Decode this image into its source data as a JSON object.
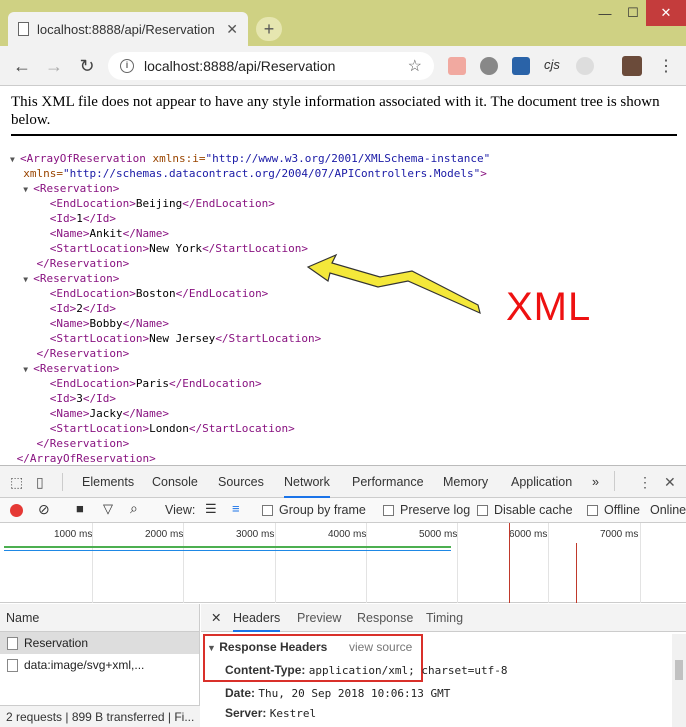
{
  "browser": {
    "tab_title": "localhost:8888/api/Reservation",
    "tab_close": "✕",
    "new_tab": "+",
    "url": "localhost:8888/api/Reservation",
    "window_controls": [
      "—",
      "☐",
      "✕"
    ]
  },
  "page": {
    "banner": "This XML file does not appear to have any style information associated with it. The document tree is shown below.",
    "annotation_label": "XML",
    "xml_root": {
      "open_tag": "<ArrayOfReservation",
      "attr1_name": " xmlns:i=",
      "attr1_value": "\"http://www.w3.org/2001/XMLSchema-instance\"",
      "attr2_name": "xmlns=",
      "attr2_value": "\"http://schemas.datacontract.org/2004/07/APIControllers.Models\"",
      "close_bracket": ">",
      "end_tag": "</ArrayOfReservation>"
    },
    "reservations": [
      {
        "EndLocation": "Beijing",
        "Id": "1",
        "Name": "Ankit",
        "StartLocation": "New York"
      },
      {
        "EndLocation": "Boston",
        "Id": "2",
        "Name": "Bobby",
        "StartLocation": "New Jersey"
      },
      {
        "EndLocation": "Paris",
        "Id": "3",
        "Name": "Jacky",
        "StartLocation": "London"
      }
    ]
  },
  "devtools": {
    "tabs": [
      "Elements",
      "Console",
      "Sources",
      "Network",
      "Performance",
      "Memory",
      "Application"
    ],
    "active_tab": "Network",
    "more": "»",
    "network_toolbar": {
      "view_label": "View:",
      "group_by_frame": "Group by frame",
      "preserve_log": "Preserve log",
      "disable_cache": "Disable cache",
      "offline": "Offline",
      "online": "Online"
    },
    "timeline_ticks": [
      "1000 ms",
      "2000 ms",
      "3000 ms",
      "4000 ms",
      "5000 ms",
      "6000 ms",
      "7000 ms"
    ],
    "name_header": "Name",
    "requests": [
      {
        "name": "Reservation",
        "selected": true
      },
      {
        "name": "data:image/svg+xml,...",
        "selected": false
      }
    ],
    "status": "2 requests | 899 B transferred | Fi...",
    "detail_tabs": [
      "Headers",
      "Preview",
      "Response",
      "Timing"
    ],
    "active_detail_tab": "Headers",
    "close_detail": "✕",
    "response_headers_title": "Response Headers",
    "view_source": "view source",
    "headers": [
      {
        "key": "Content-Type:",
        "value": "application/xml; charset=utf-8"
      },
      {
        "key": "Date:",
        "value": "Thu, 20 Sep 2018 10:06:13 GMT"
      },
      {
        "key": "Server:",
        "value": "Kestrel"
      }
    ]
  },
  "colors": {
    "titlebar": "#cfd183",
    "tag": "#881280",
    "attr_name": "#994500",
    "attr_value": "#1a1aa6",
    "annotation": "#e11",
    "highlight_box": "#d9302a",
    "active_tab_underline": "#1a73e8"
  }
}
